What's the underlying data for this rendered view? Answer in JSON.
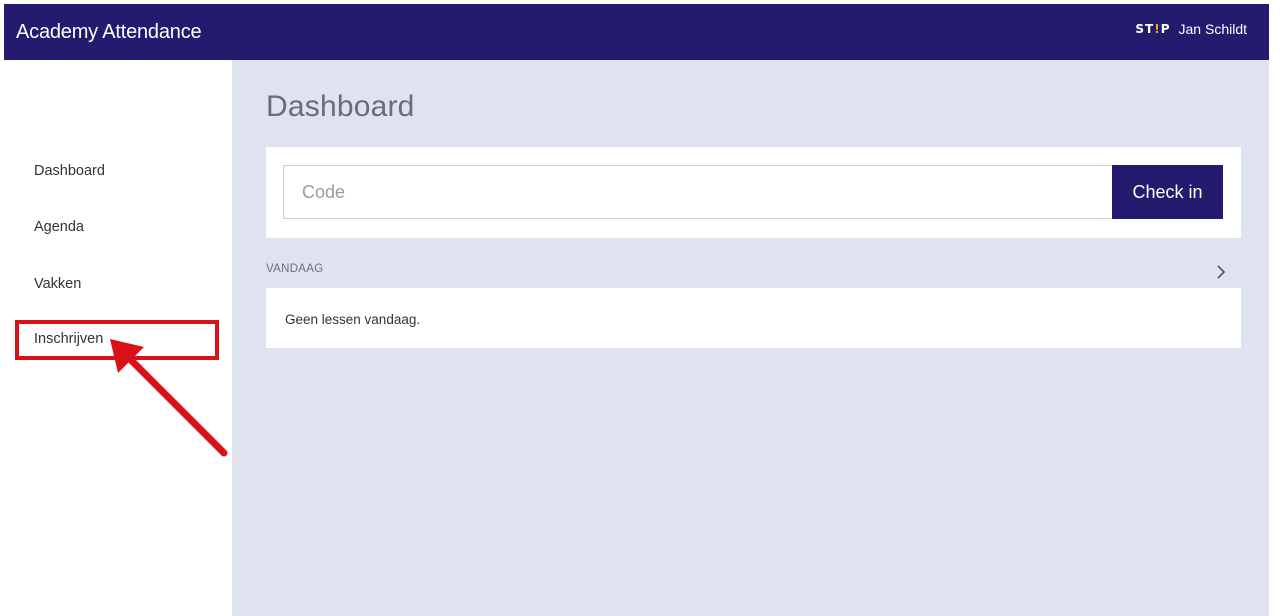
{
  "header": {
    "app_title": "Academy Attendance",
    "logo_text_left": "ST",
    "logo_text_dot": "!",
    "logo_text_right": "P",
    "user_name": "Jan Schildt",
    "background_color": "#241a6e"
  },
  "sidebar": {
    "items": [
      {
        "label": "Dashboard"
      },
      {
        "label": "Agenda"
      },
      {
        "label": "Vakken"
      },
      {
        "label": "Inschrijven"
      }
    ],
    "highlighted_item": "Inschrijven",
    "highlight_color": "#d9121a"
  },
  "main": {
    "page_title": "Dashboard",
    "checkin": {
      "placeholder": "Code",
      "value": "",
      "button_label": "Check in"
    },
    "today": {
      "section_title": "VANDAAG",
      "empty_message": "Geen lessen vandaag."
    },
    "background_color": "#dfe2ef"
  },
  "icons": {
    "chevron": "chevron-right-icon",
    "annotation": "red-arrow-icon"
  }
}
